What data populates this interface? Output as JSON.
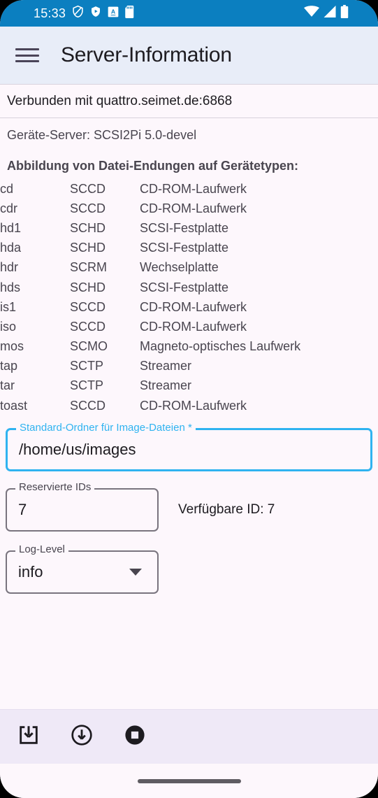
{
  "statusbar": {
    "time": "15:33",
    "left_icons": [
      "shield-slash-icon",
      "shield-play-icon",
      "a-square-icon",
      "sd-card-icon"
    ],
    "right_icons": [
      "wifi-icon",
      "cellular-signal-icon",
      "battery-icon"
    ],
    "background": "#0b7fc0"
  },
  "appbar": {
    "menu_icon": "hamburger-menu-icon",
    "title": "Server-Information",
    "background": "#e8edf8"
  },
  "content": {
    "connection_status": "Verbunden mit quattro.seimet.de:6868",
    "device_server": "Geräte-Server: SCSI2Pi 5.0-devel",
    "mapping_title": "Abbildung von Datei-Endungen auf Gerätetypen:",
    "device_map": [
      {
        "extension": "cd",
        "type": "SCCD",
        "description": "CD-ROM-Laufwerk"
      },
      {
        "extension": "cdr",
        "type": "SCCD",
        "description": "CD-ROM-Laufwerk"
      },
      {
        "extension": "hd1",
        "type": "SCHD",
        "description": "SCSI-Festplatte"
      },
      {
        "extension": "hda",
        "type": "SCHD",
        "description": "SCSI-Festplatte"
      },
      {
        "extension": "hdr",
        "type": "SCRM",
        "description": "Wechselplatte"
      },
      {
        "extension": "hds",
        "type": "SCHD",
        "description": "SCSI-Festplatte"
      },
      {
        "extension": "is1",
        "type": "SCCD",
        "description": "CD-ROM-Laufwerk"
      },
      {
        "extension": "iso",
        "type": "SCCD",
        "description": "CD-ROM-Laufwerk"
      },
      {
        "extension": "mos",
        "type": "SCMO",
        "description": "Magneto-optisches Laufwerk"
      },
      {
        "extension": "tap",
        "type": "SCTP",
        "description": "Streamer"
      },
      {
        "extension": "tar",
        "type": "SCTP",
        "description": "Streamer"
      },
      {
        "extension": "toast",
        "type": "SCCD",
        "description": "CD-ROM-Laufwerk"
      }
    ]
  },
  "form": {
    "image_folder": {
      "label": "Standard-Ordner für Image-Dateien *",
      "value": "/home/us/images",
      "focused": true,
      "accent": "#2fb3f0"
    },
    "reserved_ids": {
      "label": "Reservierte IDs",
      "value": "7"
    },
    "available_id_text": "Verfügbare ID: 7",
    "log_level": {
      "label": "Log-Level",
      "value": "info",
      "caret_icon": "chevron-down-icon"
    }
  },
  "bottombar": {
    "actions": [
      {
        "name": "save-to-tray-icon",
        "icon": "save-download-tray"
      },
      {
        "name": "download-circle-icon",
        "icon": "download-circle"
      },
      {
        "name": "stop-icon",
        "icon": "stop-filled-circle"
      }
    ],
    "background": "#efe9f7"
  },
  "gesturebar": {
    "pill": "home-gesture-pill"
  }
}
